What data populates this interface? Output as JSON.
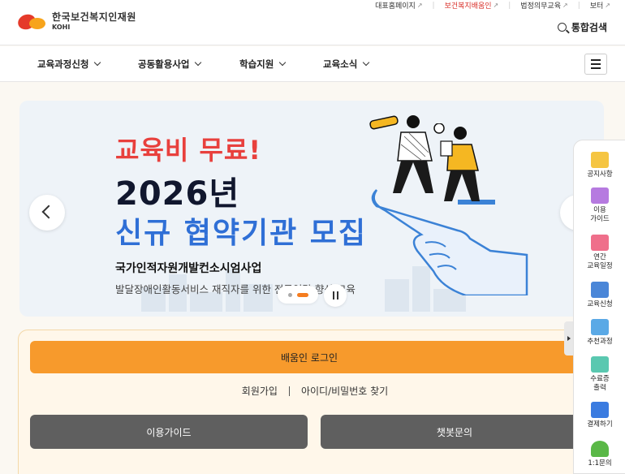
{
  "header": {
    "logo_kr": "한국보건복지인재원",
    "logo_en": "KOHI",
    "util_links": [
      {
        "label": "대표홈페이지",
        "highlight": false
      },
      {
        "label": "보건복지배움인",
        "highlight": true
      },
      {
        "label": "법정의무교육",
        "highlight": false
      },
      {
        "label": "보터",
        "highlight": false
      }
    ],
    "search_label": "통합검색"
  },
  "nav": {
    "items": [
      {
        "label": "교육과정신청"
      },
      {
        "label": "공동활용사업"
      },
      {
        "label": "학습지원"
      },
      {
        "label": "교육소식"
      }
    ]
  },
  "banner": {
    "line1": "교육비 무료!",
    "line2": "2026년",
    "line3": "신규 협약기관 모집",
    "line4": "국가인적자원개발컨소시엄사업",
    "line5": "발달장애인활동서비스 재직자를 위한 전문역량 향상 교육",
    "slides_total": 2,
    "current_slide": 2
  },
  "login": {
    "login_label": "배움인 로그인",
    "signup_label": "회원가입",
    "find_label": "아이디/비밀번호 찾기",
    "guide_label": "이용가이드",
    "chatbot_label": "챗봇문의"
  },
  "quick_menu": {
    "items": [
      {
        "label": "공지사항",
        "icon": "notice-icon",
        "color": "#f5c542"
      },
      {
        "label": "이용\n가이드",
        "icon": "guide-book-icon",
        "color": "#b67ae0"
      },
      {
        "label": "연간\n교육일정",
        "icon": "calendar-icon",
        "color": "#ef6f8b"
      },
      {
        "label": "교육신청",
        "icon": "application-form-icon",
        "color": "#4a86d8"
      },
      {
        "label": "추천과정",
        "icon": "thumbs-up-icon",
        "color": "#5aa9e6"
      },
      {
        "label": "수료증\n출력",
        "icon": "certificate-icon",
        "color": "#5ac8b0"
      },
      {
        "label": "결제하기",
        "icon": "payment-icon",
        "color": "#3a7be0"
      },
      {
        "label": "1:1문의",
        "icon": "person-inquiry-icon",
        "color": "#5ab847"
      }
    ]
  },
  "colors": {
    "accent_orange": "#f79a2c",
    "brand_red": "#e53a2a",
    "banner_blue": "#2f6fd6",
    "dark_button": "#5f5f5f"
  }
}
